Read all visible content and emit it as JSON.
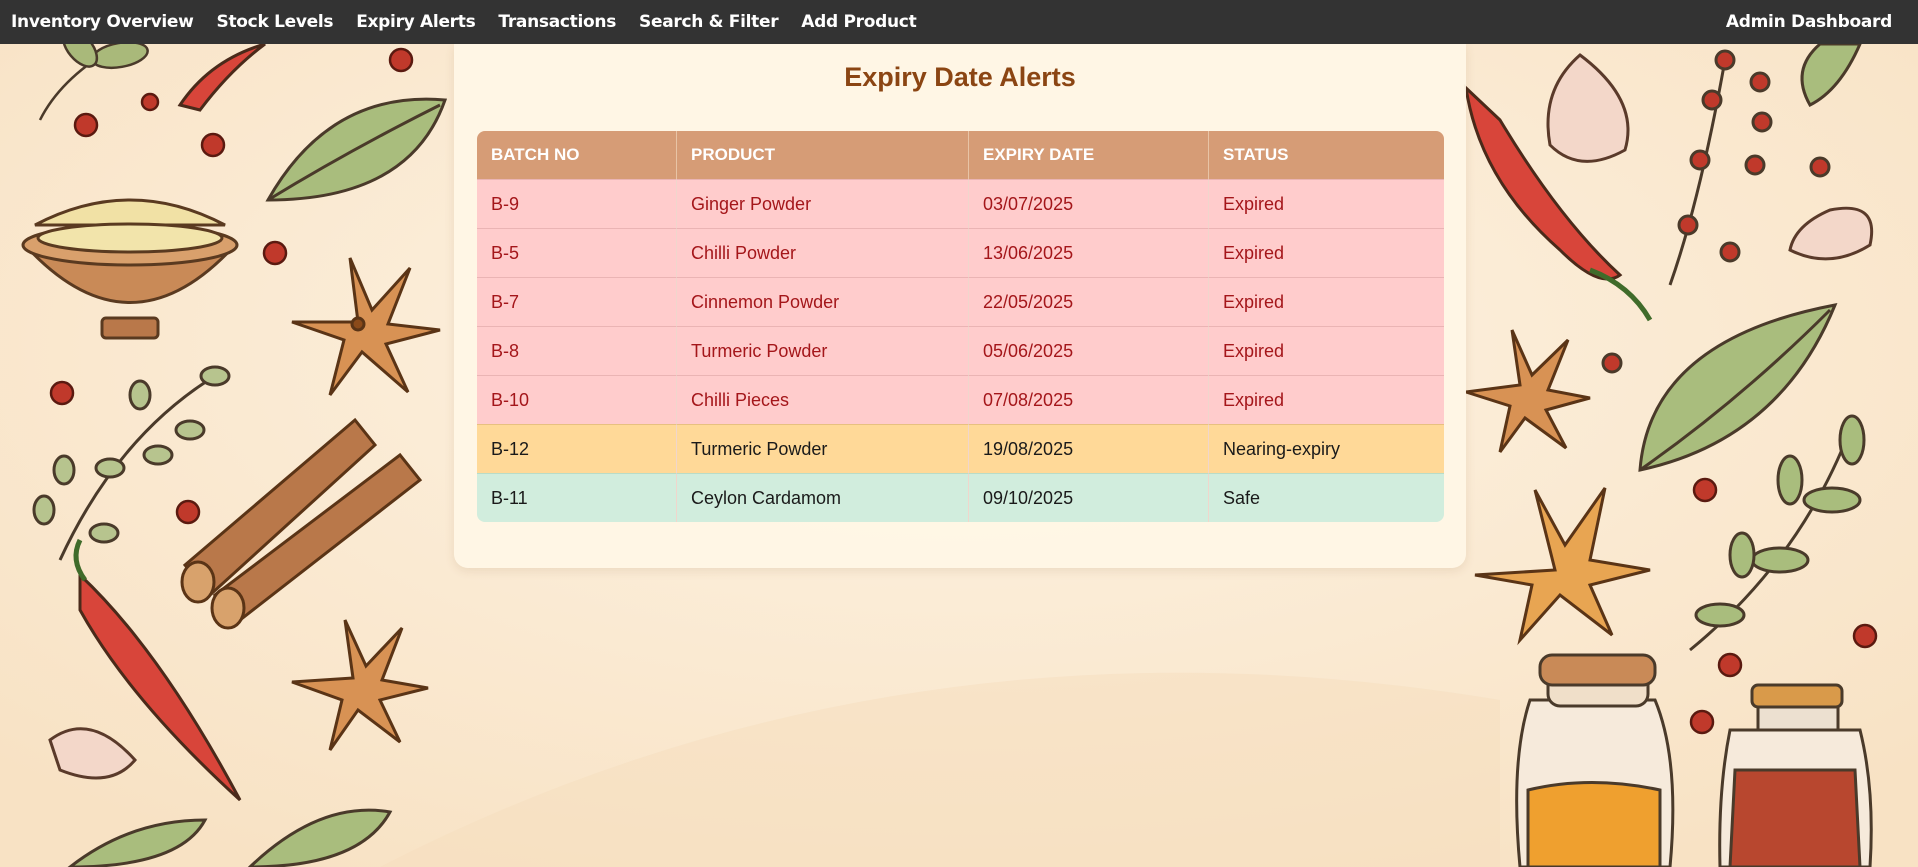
{
  "nav": {
    "links": [
      "Inventory Overview",
      "Stock Levels",
      "Expiry Alerts",
      "Transactions",
      "Search & Filter",
      "Add Product"
    ],
    "right": "Admin Dashboard"
  },
  "page": {
    "title": "Expiry Date Alerts"
  },
  "table": {
    "headers": [
      "BATCH NO",
      "PRODUCT",
      "EXPIRY DATE",
      "STATUS"
    ],
    "rows": [
      {
        "batch": "B-9",
        "product": "Ginger Powder",
        "expiry": "03/07/2025",
        "status": "Expired"
      },
      {
        "batch": "B-5",
        "product": "Chilli Powder",
        "expiry": "13/06/2025",
        "status": "Expired"
      },
      {
        "batch": "B-7",
        "product": "Cinnemon Powder",
        "expiry": "22/05/2025",
        "status": "Expired"
      },
      {
        "batch": "B-8",
        "product": "Turmeric Powder",
        "expiry": "05/06/2025",
        "status": "Expired"
      },
      {
        "batch": "B-10",
        "product": "Chilli Pieces",
        "expiry": "07/08/2025",
        "status": "Expired"
      },
      {
        "batch": "B-12",
        "product": "Turmeric Powder",
        "expiry": "19/08/2025",
        "status": "Nearing-expiry"
      },
      {
        "batch": "B-11",
        "product": "Ceylon Cardamom",
        "expiry": "09/10/2025",
        "status": "Safe"
      }
    ]
  },
  "colors": {
    "navbar": "#333333",
    "title": "#8b4513",
    "header": "#d69c76",
    "expired_bg": "#ffcccc",
    "expired_text": "#a4161a",
    "nearing_bg": "#ffd998",
    "safe_bg": "#d1eddd"
  },
  "background_icons": [
    "chili-icon",
    "bay-leaf-icon",
    "star-anise-icon",
    "cinnamon-icon",
    "garlic-icon",
    "peppercorn-icon",
    "spice-bowl-icon",
    "spice-jar-icon",
    "herb-sprig-icon"
  ]
}
